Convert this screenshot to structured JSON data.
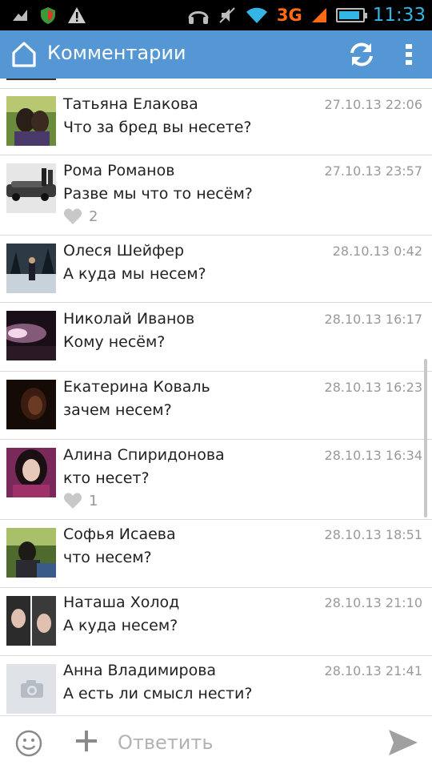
{
  "status_bar": {
    "time": "11:33",
    "network": "3G",
    "battery_level": 0.9,
    "icons": [
      "usb-icon",
      "shield-icon",
      "warning-icon",
      "headphones-icon",
      "mute-icon",
      "wifi-icon",
      "signal-icon",
      "battery-icon"
    ]
  },
  "app_bar": {
    "title": "Комментарии",
    "icons": [
      "home-icon",
      "refresh-icon",
      "overflow-menu-icon"
    ],
    "accent": "#5597d4"
  },
  "comments": [
    {
      "name": "Татьяна Елакова",
      "date": "27.10.13 22:06",
      "text": "Что за бред вы несете?",
      "likes": null,
      "avatar_color": "#6a8a3c"
    },
    {
      "name": "Рома Романов",
      "date": "27.10.13 23:57",
      "text": "Разве мы что то несём?",
      "likes": "2",
      "avatar_color": "#c9c9c9"
    },
    {
      "name": "Олеся Шейфер",
      "date": "28.10.13 0:42",
      "text": "А куда мы несем?",
      "likes": null,
      "avatar_color": "#2d3a44"
    },
    {
      "name": "Николай Иванов",
      "date": "28.10.13 16:17",
      "text": "Кому несём?",
      "likes": null,
      "avatar_color": "#3a1e2e"
    },
    {
      "name": "Екатерина Коваль",
      "date": "28.10.13 16:23",
      "text": "зачем несем?",
      "likes": null,
      "avatar_color": "#1a0c08"
    },
    {
      "name": "Алина Спиридонова",
      "date": "28.10.13 16:34",
      "text": "кто несет?",
      "likes": "1",
      "avatar_color": "#7a2a5a"
    },
    {
      "name": "Софья Исаева",
      "date": "28.10.13 18:51",
      "text": "что несем?",
      "likes": null,
      "avatar_color": "#4e6a2c"
    },
    {
      "name": "Наташа Холод",
      "date": "28.10.13 21:10",
      "text": "А куда несем?",
      "likes": null,
      "avatar_color": "#2b2b2b"
    },
    {
      "name": "Анна Владимирова",
      "date": "28.10.13 21:41",
      "text": "А есть ли смысл нести?",
      "likes": null,
      "avatar_color": "#dfe3e8"
    }
  ],
  "composer": {
    "reply_placeholder": "Ответить",
    "reply_value": "",
    "icons": [
      "emoji-icon",
      "plus-icon",
      "send-icon"
    ]
  }
}
